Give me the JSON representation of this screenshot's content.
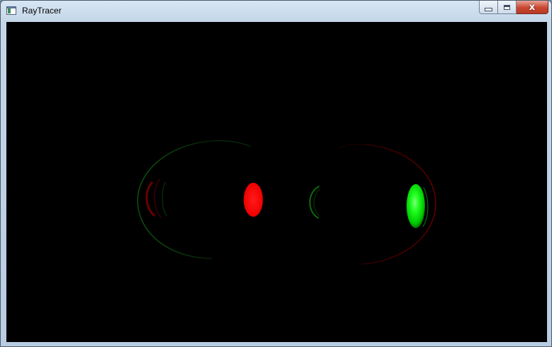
{
  "window": {
    "title": "RayTracer",
    "caption_buttons": {
      "minimize": "minimize",
      "maximize": "maximize",
      "close": "close"
    },
    "icons": {
      "app": "app-window-icon",
      "minimize": "minimize-icon",
      "maximize": "maximize-icon",
      "close": "close-icon",
      "close_glyph": "x"
    }
  },
  "render": {
    "background": "#000000",
    "colors": {
      "red": "#ff0000",
      "green": "#00ff00",
      "red_dim": "#5a0000",
      "green_dim": "#004400"
    }
  }
}
